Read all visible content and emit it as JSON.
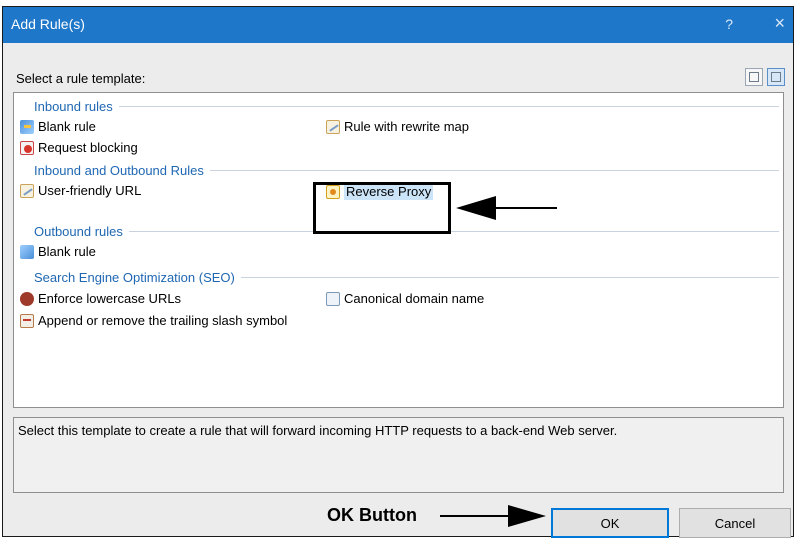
{
  "window": {
    "title": "Add Rule(s)",
    "help_icon": "?",
    "close_icon": "×"
  },
  "select_label": "Select a rule template:",
  "groups": [
    {
      "label": "Inbound rules"
    },
    {
      "label": "Inbound and Outbound Rules"
    },
    {
      "label": "Outbound rules"
    },
    {
      "label": "Search Engine Optimization (SEO)"
    }
  ],
  "items": {
    "blank_rule_in": "Blank rule",
    "rule_with_rewrite_map": "Rule with rewrite map",
    "request_blocking": "Request blocking",
    "user_friendly_url": "User-friendly URL",
    "reverse_proxy": "Reverse Proxy",
    "blank_rule_out": "Blank rule",
    "enforce_lowercase": "Enforce lowercase URLs",
    "canonical_domain": "Canonical domain name",
    "trailing_slash": "Append or remove the trailing slash symbol"
  },
  "description": "Select this template to create a rule that will forward incoming HTTP requests to a back-end Web server.",
  "buttons": {
    "ok": "OK",
    "cancel": "Cancel"
  },
  "annotations": {
    "ok_button_label": "OK Button"
  },
  "colors": {
    "title_bar": "#1f77c9",
    "group_text": "#1f67b3",
    "selected_bg": "#cce4f7"
  }
}
